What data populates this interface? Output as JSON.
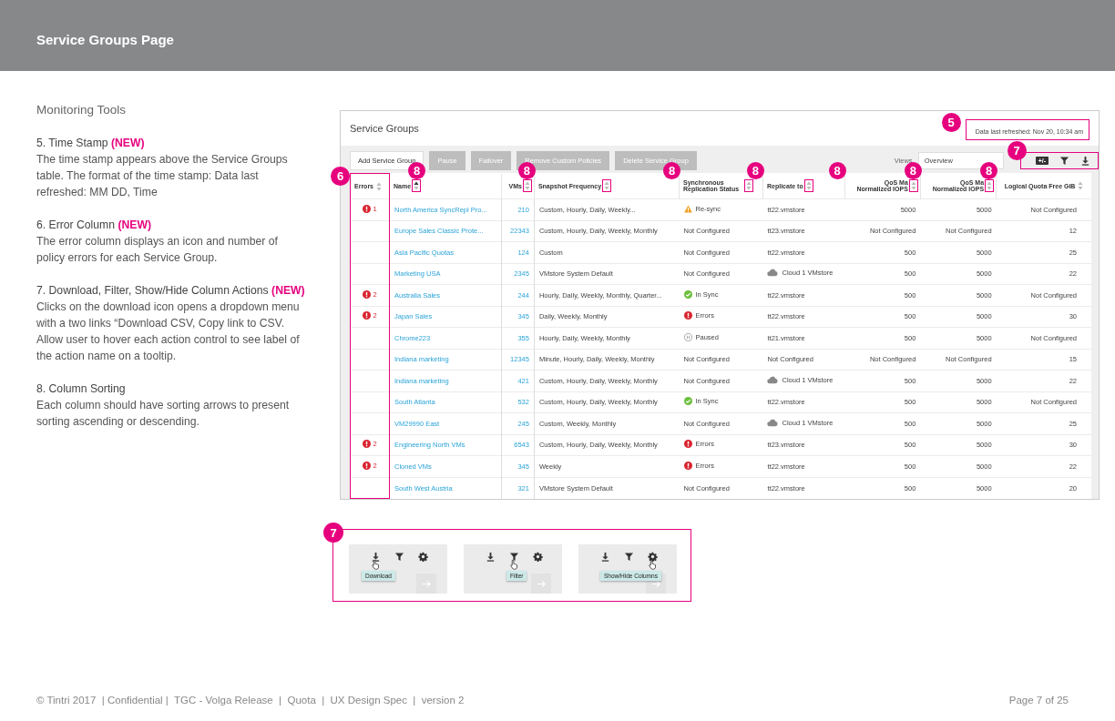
{
  "header": {
    "title": "Service Groups Page"
  },
  "notes": {
    "heading": "Monitoring Tools",
    "items": [
      {
        "title": "5. Time Stamp",
        "badge": "(NEW)",
        "body": "The time stamp appears above the Service Groups table. The format of the time stamp: Data last refreshed: MM DD, Time"
      },
      {
        "title": "6. Error Column",
        "badge": "(NEW)",
        "body": "The error column displays an icon and number of policy errors for each Service Group."
      },
      {
        "title": "7. Download, Filter, Show/Hide Column Actions",
        "badge": "(NEW)",
        "body": "Clicks on the download icon opens a dropdown menu with a two links “Download CSV, Copy link to CSV. Allow user to hover each action control to see label of the action name on a tooltip."
      },
      {
        "title": "8. Column Sorting",
        "body": "Each column should have sorting arrows to present sorting ascending or descending."
      }
    ]
  },
  "mockup": {
    "title": "Service Groups",
    "timestamp": {
      "text": "Data last refreshed: Nov 20, 10:34 am",
      "marker": "5"
    },
    "toolbar": {
      "buttons": [
        {
          "label": "Add Service Group",
          "disabled": false
        },
        {
          "label": "Pause",
          "disabled": true
        },
        {
          "label": "Failover",
          "disabled": true
        },
        {
          "label": "Remove Custom Policies",
          "disabled": true
        },
        {
          "label": "Delete Service Group",
          "disabled": true
        }
      ],
      "views_label": "Views",
      "views_value": "Overview",
      "tools_marker": "7",
      "tools": [
        {
          "kind": "columns",
          "label": "+/-"
        },
        {
          "kind": "filter"
        },
        {
          "kind": "download"
        }
      ]
    },
    "table": {
      "errors_marker": "6",
      "columns": [
        {
          "label": "Errors",
          "sorted": false
        },
        {
          "label": "Name",
          "sorted": true,
          "marker": "8"
        },
        {
          "label": "VMs",
          "sorted": false,
          "marker": "8"
        },
        {
          "label": "Snapshot Frequency",
          "sorted": false,
          "marker": "8"
        },
        {
          "label": "Synchronous Replication Status",
          "sorted": false,
          "marker": "8"
        },
        {
          "label": "Replicate to",
          "sorted": false,
          "marker": "8"
        },
        {
          "label": "QoS Ma Normalized IOPS",
          "sorted": false,
          "marker": "8"
        },
        {
          "label": "QoS Ma Normalized IOPS",
          "sorted": false,
          "marker": "8"
        },
        {
          "label": "Logical Quota Free GiB",
          "sorted": false
        }
      ],
      "rows": [
        {
          "errors": "1",
          "name": "North America SyncRepl Pro...",
          "vms": "210",
          "frequency": "Custom, Hourly, Daily, Weekly...",
          "status": {
            "kind": "resync",
            "text": "Re-sync"
          },
          "replicate": {
            "kind": "plain",
            "text": "tt22.vmstore"
          },
          "qos_1": "5000",
          "qos_2": "5000",
          "quota": "Not Configured"
        },
        {
          "name": "Europe Sales Classic Prote...",
          "vms": "22343",
          "frequency": "Custom, Hourly, Daily, Weekly, Monthly",
          "status": {
            "kind": "none",
            "text": "Not Configured"
          },
          "replicate": {
            "kind": "plain",
            "text": "tt23.vmstore"
          },
          "qos_1": "Not Configured",
          "qos_2": "Not Configured",
          "quota": "12"
        },
        {
          "name": "Asia Pacific Quotas",
          "vms": "124",
          "frequency": "Custom",
          "status": {
            "kind": "none",
            "text": "Not Configured"
          },
          "replicate": {
            "kind": "plain",
            "text": "tt22.vmstore"
          },
          "qos_1": "500",
          "qos_2": "5000",
          "quota": "25"
        },
        {
          "name": "Marketing USA",
          "vms": "2345",
          "frequency": "VMstore System Default",
          "status": {
            "kind": "none",
            "text": "Not Configured"
          },
          "replicate": {
            "kind": "cloud",
            "text": "Cloud 1 VMstore"
          },
          "qos_1": "500",
          "qos_2": "5000",
          "quota": "22"
        },
        {
          "errors": "2",
          "name": "Australia Sales",
          "vms": "244",
          "frequency": "Hourly, Daily, Weekly, Monthly, Quarter...",
          "status": {
            "kind": "insync",
            "text": "In Sync"
          },
          "replicate": {
            "kind": "plain",
            "text": "tt22.vmstore"
          },
          "qos_1": "500",
          "qos_2": "5000",
          "quota": "Not Configured"
        },
        {
          "errors": "2",
          "name": "Japan Sales",
          "vms": "345",
          "frequency": "Daily, Weekly, Monthly",
          "status": {
            "kind": "errors",
            "text": "Errors"
          },
          "replicate": {
            "kind": "plain",
            "text": "tt22.vmstore"
          },
          "qos_1": "500",
          "qos_2": "5000",
          "quota": "30"
        },
        {
          "name": "Chrome223",
          "vms": "355",
          "frequency": "Hourly, Daily, Weekly, Monthly",
          "status": {
            "kind": "paused",
            "text": "Paused"
          },
          "replicate": {
            "kind": "plain",
            "text": "tt21.vmstore"
          },
          "qos_1": "500",
          "qos_2": "5000",
          "quota": "Not Configured"
        },
        {
          "name": "Indiana marketing",
          "vms": "12345",
          "frequency": "Minute, Hourly, Daily, Weekly, Monthly",
          "status": {
            "kind": "none",
            "text": "Not Configured"
          },
          "replicate": {
            "kind": "plain",
            "text": "Not Configured"
          },
          "qos_1": "Not Configured",
          "qos_2": "Not Configured",
          "quota": "15"
        },
        {
          "name": "Indiana marketing",
          "vms": "421",
          "frequency": "Custom, Hourly, Daily, Weekly, Monthly",
          "status": {
            "kind": "none",
            "text": "Not Configured"
          },
          "replicate": {
            "kind": "cloud",
            "text": "Cloud 1 VMstore"
          },
          "qos_1": "500",
          "qos_2": "5000",
          "quota": "22"
        },
        {
          "name": "South Atlanta",
          "vms": "532",
          "frequency": "Custom, Hourly, Daily, Weekly, Monthly",
          "status": {
            "kind": "insync",
            "text": "In Sync"
          },
          "replicate": {
            "kind": "plain",
            "text": "tt22.vmstore"
          },
          "qos_1": "500",
          "qos_2": "5000",
          "quota": "Not Configured"
        },
        {
          "name": "VM29990 East",
          "vms": "245",
          "frequency": "Custom, Weekly, Monthly",
          "status": {
            "kind": "none",
            "text": "Not Configured"
          },
          "replicate": {
            "kind": "cloud",
            "text": "Cloud 1 VMstore"
          },
          "qos_1": "500",
          "qos_2": "5000",
          "quota": "25"
        },
        {
          "errors": "2",
          "name": "Engineering North VMs",
          "vms": "6543",
          "frequency": "Custom, Hourly, Daily, Weekly, Monthly",
          "status": {
            "kind": "errors",
            "text": "Errors"
          },
          "replicate": {
            "kind": "plain",
            "text": "tt23.vmstore"
          },
          "qos_1": "500",
          "qos_2": "5000",
          "quota": "30"
        },
        {
          "errors": "2",
          "name": "Cloned VMs",
          "vms": "345",
          "frequency": "Weekly",
          "status": {
            "kind": "errors",
            "text": "Errors"
          },
          "replicate": {
            "kind": "plain",
            "text": "tt22.vmstore"
          },
          "qos_1": "500",
          "qos_2": "5000",
          "quota": "22"
        },
        {
          "name": "South West Austria",
          "vms": "321",
          "frequency": "VMstore System Default",
          "status": {
            "kind": "none",
            "text": "Not Configured"
          },
          "replicate": {
            "kind": "plain",
            "text": "tt22.vmstore"
          },
          "qos_1": "500",
          "qos_2": "5000",
          "quota": "20"
        }
      ]
    }
  },
  "examples": {
    "marker": "7",
    "items": [
      {
        "tooltip": "Download",
        "icons": [
          {
            "kind": "download",
            "hovered": true
          },
          {
            "kind": "filter",
            "hovered": false
          },
          {
            "kind": "settings",
            "hovered": false
          }
        ]
      },
      {
        "tooltip": "Filter",
        "icons": [
          {
            "kind": "download",
            "hovered": false
          },
          {
            "kind": "filter",
            "hovered": true
          },
          {
            "kind": "settings",
            "hovered": false
          }
        ]
      },
      {
        "tooltip": "Show/Hide Columns",
        "icons": [
          {
            "kind": "download",
            "hovered": false
          },
          {
            "kind": "filter",
            "hovered": false
          },
          {
            "kind": "settings",
            "hovered": true
          }
        ]
      }
    ]
  },
  "footer": {
    "left": "© Tintri 2017  | Confidential |  TGC - Volga Release  |  Quota  |  UX Design Spec  |  version 2",
    "right": "Page 7 of 25"
  }
}
